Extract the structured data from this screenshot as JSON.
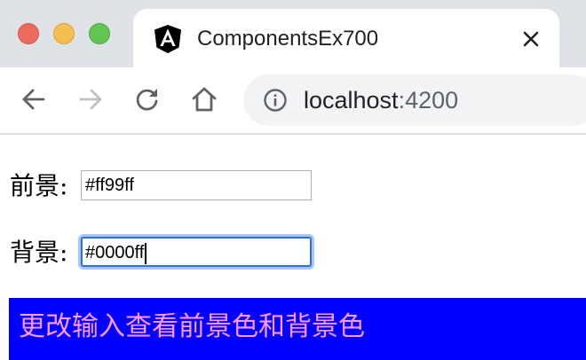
{
  "browser": {
    "tab": {
      "title": "ComponentsEx700",
      "icon": "angular-logo-icon"
    },
    "address_bar": {
      "host": "localhost",
      "port": ":4200",
      "security_icon": "info-icon"
    },
    "nav": {
      "back_icon": "arrow-left-icon",
      "forward_icon": "arrow-right-icon",
      "reload_icon": "reload-icon",
      "home_icon": "home-icon"
    }
  },
  "form": {
    "foreground": {
      "label": "前景:",
      "value": "#ff99ff"
    },
    "background": {
      "label": "背景:",
      "value": "#0000ff"
    }
  },
  "preview": {
    "text": "更改输入查看前景色和背景色",
    "color": "#ff99ff",
    "background": "#0000ff"
  },
  "colors": {
    "focus_ring": "#2f6fe0",
    "tabstrip": "#dee1e6",
    "omnibox": "#f1f3f4"
  }
}
